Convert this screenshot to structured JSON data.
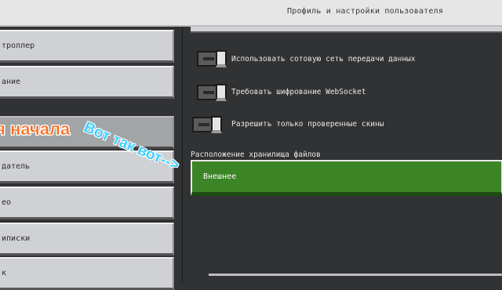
{
  "title_bar": {
    "title": "Профиль и настройки пользователя"
  },
  "sidebar": {
    "items": [
      {
        "label": "троллер"
      },
      {
        "label": "ание"
      },
      {
        "label": ""
      },
      {
        "label": ""
      },
      {
        "label": "датель"
      },
      {
        "label": "ео"
      },
      {
        "label": "иписки"
      },
      {
        "label": "к"
      }
    ],
    "active_index": 3
  },
  "settings": {
    "toggles": [
      {
        "label": "Использовать сотовую сеть передачи данных",
        "enabled": false
      },
      {
        "label": "Требовать шифрование WebSocket",
        "enabled": false
      },
      {
        "label": "Разрешить только проверенные скины",
        "enabled": false
      }
    ],
    "storage": {
      "label": "Расположение хранилища файлов",
      "value": "Внешнее"
    }
  },
  "overlays": {
    "text1": "я начала",
    "text2": "Вот так вот-->"
  },
  "colors": {
    "accent_green": "#3c8527",
    "background": "#313233",
    "button_gray": "#d0d1d4",
    "overlay_orange": "#ff6a1a",
    "overlay_blue": "#3fd0ff"
  }
}
